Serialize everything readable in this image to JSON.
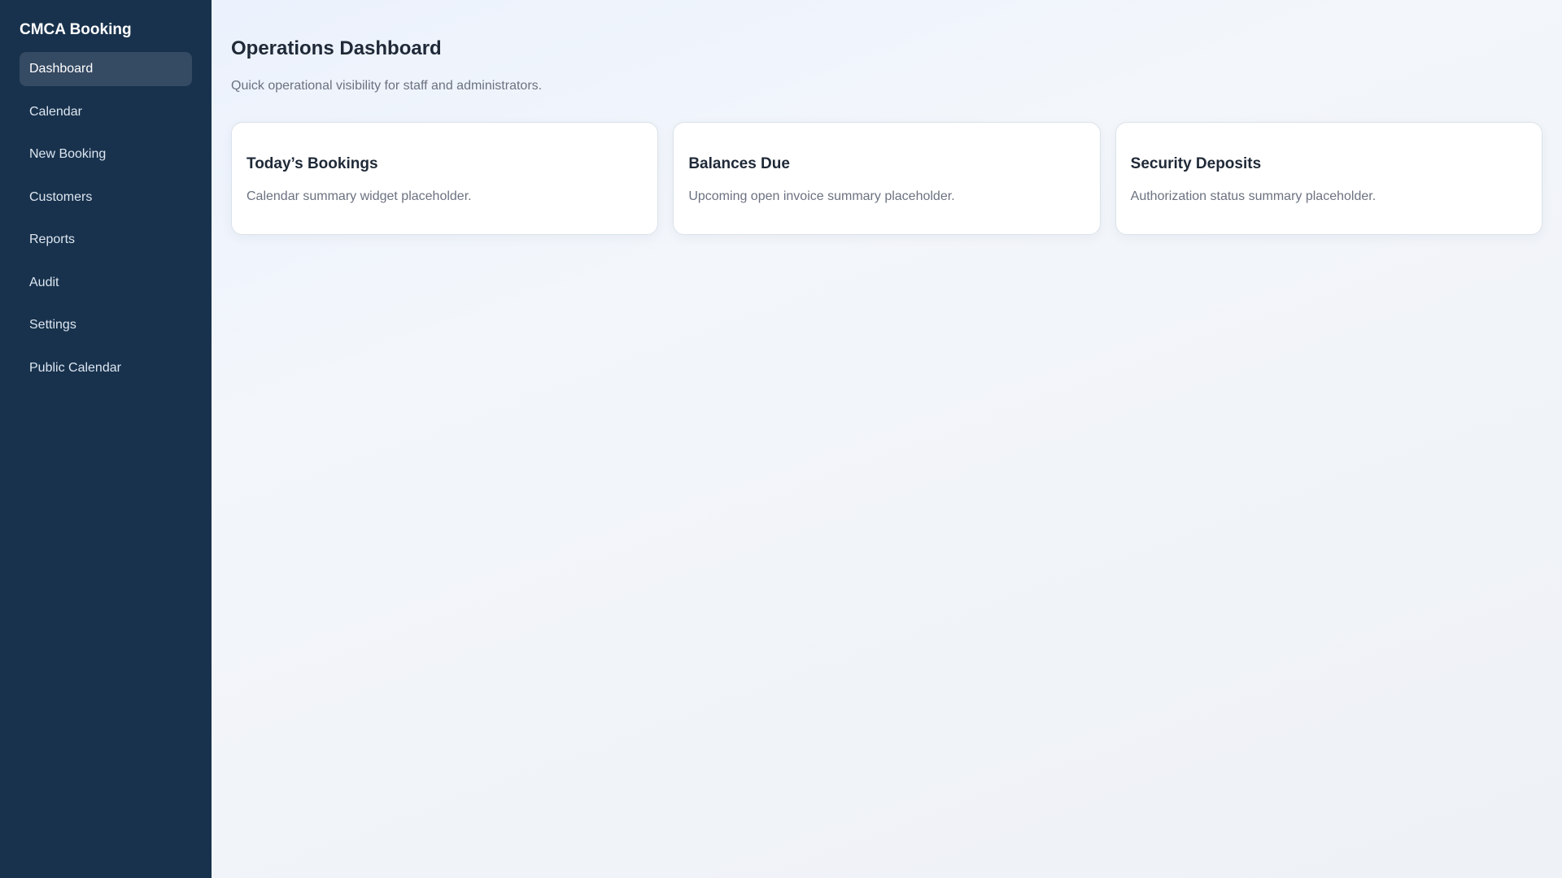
{
  "sidebar": {
    "brand": "CMCA Booking",
    "items": [
      {
        "label": "Dashboard"
      },
      {
        "label": "Calendar"
      },
      {
        "label": "New Booking"
      },
      {
        "label": "Customers"
      },
      {
        "label": "Reports"
      },
      {
        "label": "Audit"
      },
      {
        "label": "Settings"
      },
      {
        "label": "Public Calendar"
      }
    ],
    "active": "Dashboard"
  },
  "main": {
    "title": "Operations Dashboard",
    "subtitle": "Quick operational visibility for staff and administrators.",
    "cards": [
      {
        "title": "Today’s Bookings",
        "description": "Calendar summary widget placeholder."
      },
      {
        "title": "Balances Due",
        "description": "Upcoming open invoice summary placeholder."
      },
      {
        "title": "Security Deposits",
        "description": "Authorization status summary placeholder."
      }
    ]
  },
  "colors": {
    "sidebar": "#18324d",
    "active_item": "#354a63"
  }
}
